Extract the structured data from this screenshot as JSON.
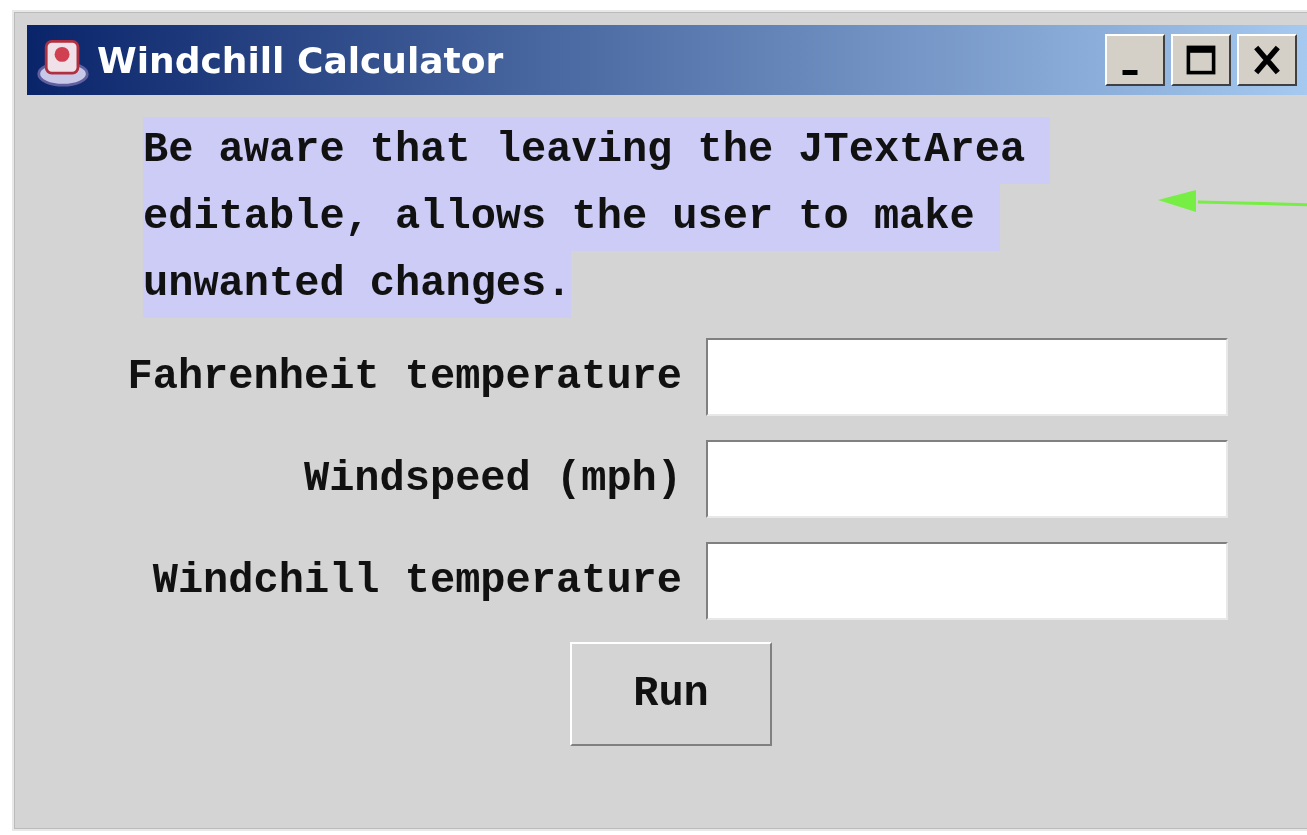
{
  "window": {
    "title": "Windchill Calculator"
  },
  "text_area": {
    "selected": true,
    "lines": [
      "Be aware that leaving the JTextArea ",
      "editable, allows the user to make ",
      "unwanted changes."
    ]
  },
  "fields": [
    {
      "label": "Fahrenheit temperature"
    },
    {
      "label": "Windspeed (mph)"
    },
    {
      "label": "Windchill temperature"
    }
  ],
  "buttons": [
    "Run"
  ]
}
